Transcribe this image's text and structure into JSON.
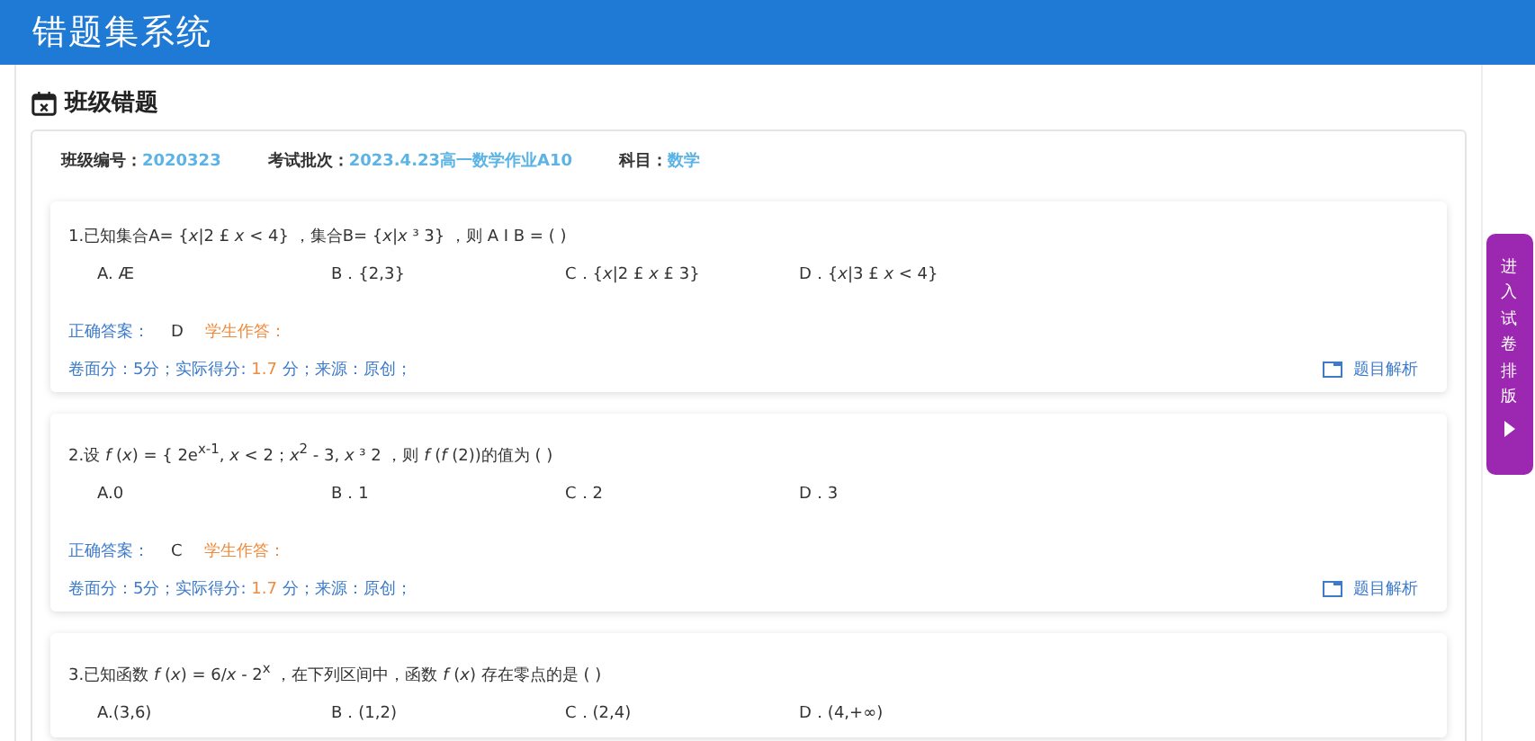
{
  "header": {
    "title": "错题集系统"
  },
  "section": {
    "title": "班级错题"
  },
  "info": [
    {
      "label": "班级编号：",
      "value": "2020323"
    },
    {
      "label": "考试批次：",
      "value": "2023.4.23高一数学作业A10"
    },
    {
      "label": "科目：",
      "value": "数学"
    }
  ],
  "questions": [
    {
      "stem": "1.已知集合A= {*x*|2 £ *x* < 4} ，集合B= {*x*|*x* ³ 3} ，则 A I B = (     )",
      "options": [
        "A. Æ",
        "B．{2,3}",
        "C．{*x*|2 £ *x* £ 3}",
        "D．{*x*|3 £ *x* < 4}"
      ],
      "correct_label": "正确答案：",
      "correct": "D",
      "student_label": "学生作答：",
      "score_before": "卷面分：5分；实际得分:",
      "score_actual": "1.7",
      "score_after": "分；来源：原创；",
      "analysis": "题目解析"
    },
    {
      "stem": "2.设 *f* (*x*) = { 2e$^{x-1}$, *x* < 2；*x*$^{2}$ - 3, *x* ³ 2 ，则 *f* (*f* (2))的值为 (     )",
      "options": [
        "A.0",
        "B．1",
        "C．2",
        "D．3"
      ],
      "correct_label": "正确答案：",
      "correct": "C",
      "student_label": "学生作答：",
      "score_before": "卷面分：5分；实际得分:",
      "score_actual": "1.7",
      "score_after": "分；来源：原创；",
      "analysis": "题目解析"
    },
    {
      "stem": "3.已知函数 *f* (*x*) = 6/*x* - 2$^{x}$ ，在下列区间中，函数 *f* (*x*) 存在零点的是 (     )",
      "options": [
        "A.(3,6)",
        "B．(1,2)",
        "C．(2,4)",
        "D．(4,+∞)"
      ]
    }
  ],
  "side_button": {
    "label": "进入试卷排版"
  }
}
